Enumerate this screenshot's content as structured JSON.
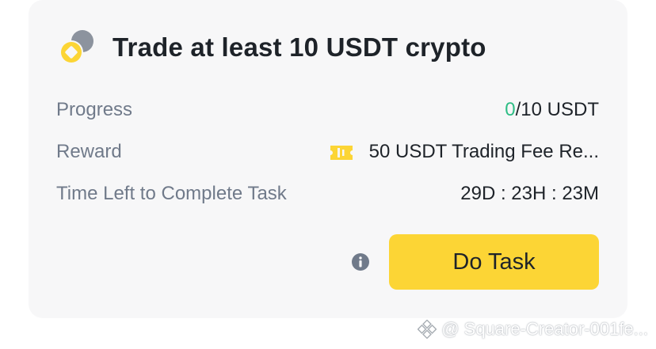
{
  "task": {
    "title": "Trade at least 10 USDT crypto",
    "icon": "coin-icon"
  },
  "rows": {
    "progress": {
      "label": "Progress",
      "current": "0",
      "target": "/10 USDT"
    },
    "reward": {
      "label": "Reward",
      "icon": "ticket-icon",
      "value": "50 USDT Trading Fee Re..."
    },
    "time_left": {
      "label": "Time Left to Complete Task",
      "value": "29D : 23H : 23M"
    }
  },
  "actions": {
    "info_icon": "info-icon",
    "do_task_label": "Do Task"
  },
  "watermark": {
    "text": "@ Square-Creator-001fe..."
  },
  "colors": {
    "accent": "#fcd535",
    "progress_current": "#2ebd85",
    "text_primary": "#1e2329",
    "text_secondary": "#707a8a",
    "card_background": "#f7f7f8"
  }
}
